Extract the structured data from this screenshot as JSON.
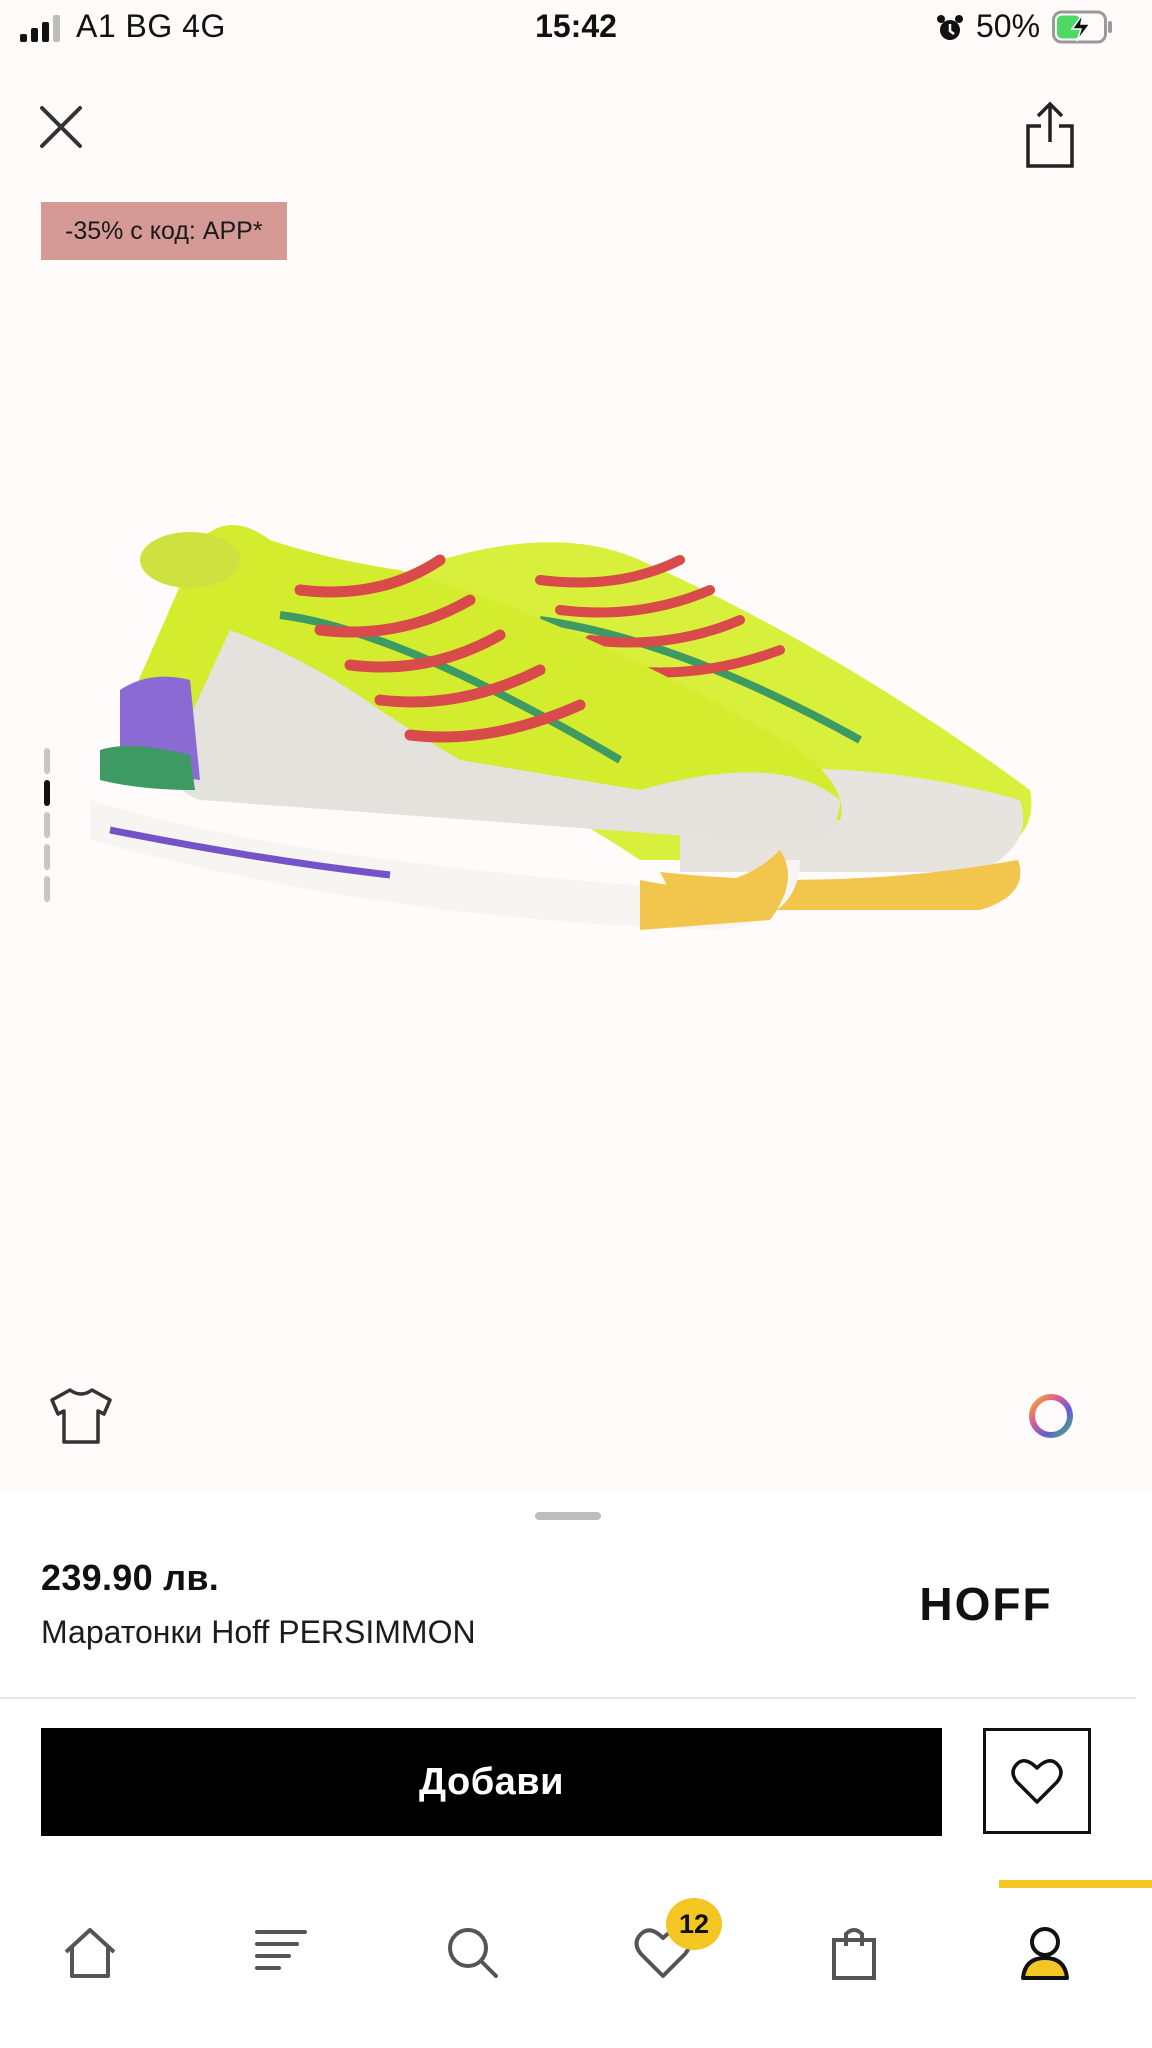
{
  "status_bar": {
    "carrier": "A1 BG   4G",
    "time": "15:42",
    "battery_percent": "50%",
    "battery_level": 0.5,
    "signal_bars": 3
  },
  "promo": {
    "label": "-35% с код: APP*"
  },
  "gallery": {
    "image_count": 5,
    "active_index": 1
  },
  "product": {
    "price": "239.90 лв.",
    "name": "Маратонки Hoff PERSIMMON",
    "brand": "HOFF"
  },
  "actions": {
    "add_label": "Добави"
  },
  "tab_bar": {
    "tabs": [
      "home",
      "catalog",
      "search",
      "wishlist",
      "bag",
      "account"
    ],
    "active": "account",
    "wishlist_badge": "12"
  },
  "colors": {
    "accent": "#f4c623",
    "promo_bg": "#d59996",
    "button_bg": "#000000"
  }
}
